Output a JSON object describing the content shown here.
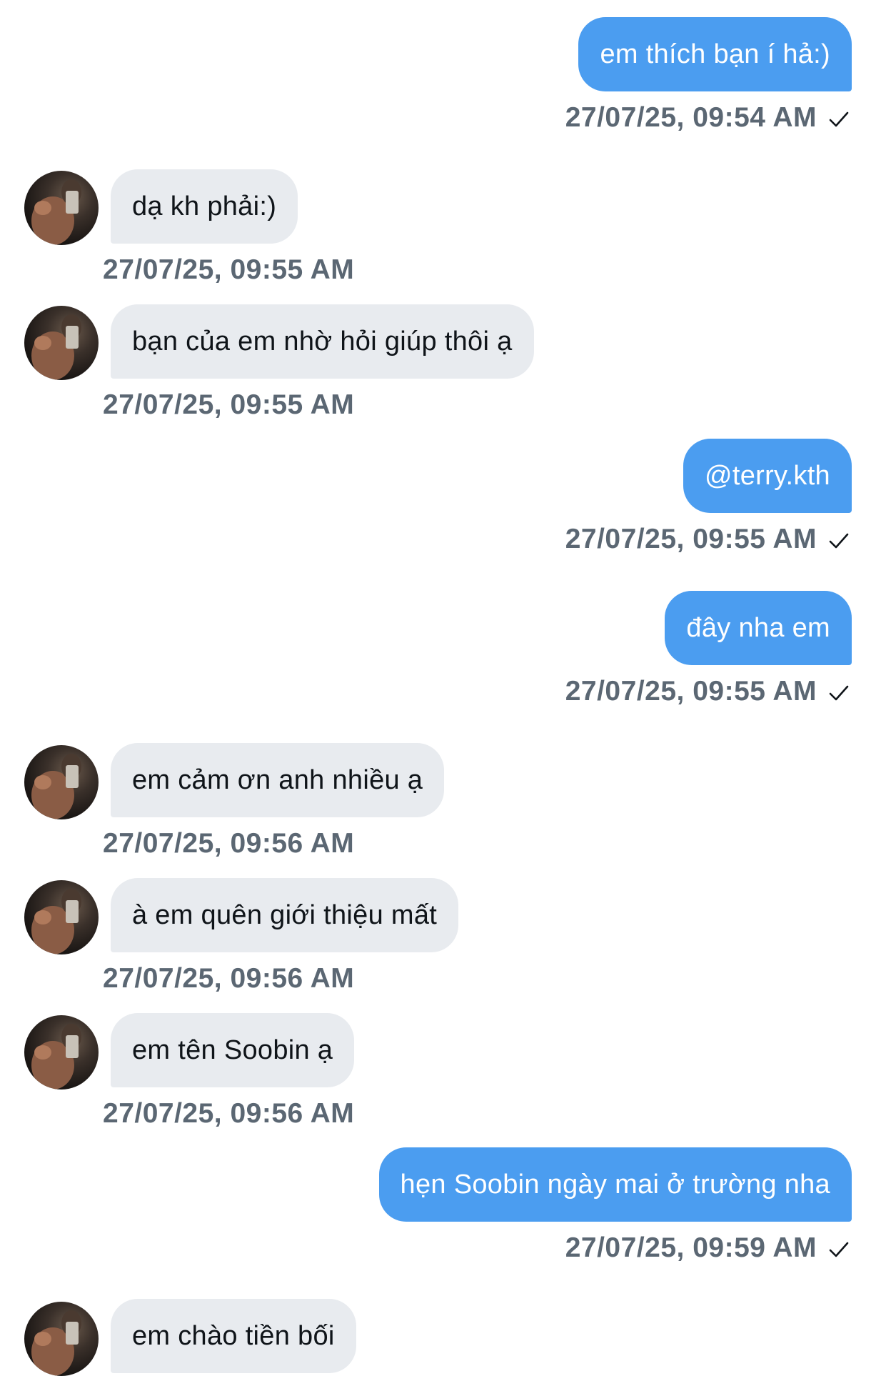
{
  "messages": [
    {
      "dir": "out",
      "text": "em thích bạn í hả:)",
      "time": "27/07/25, 09:54 AM"
    },
    {
      "dir": "in",
      "text": "dạ kh phải:)",
      "time": "27/07/25, 09:55 AM"
    },
    {
      "dir": "in",
      "text": "bạn của em nhờ hỏi giúp thôi ạ",
      "time": "27/07/25, 09:55 AM"
    },
    {
      "dir": "out",
      "text": "@terry.kth",
      "time": "27/07/25, 09:55 AM"
    },
    {
      "dir": "out",
      "text": "đây nha em",
      "time": "27/07/25, 09:55 AM"
    },
    {
      "dir": "in",
      "text": "em cảm ơn anh nhiều ạ",
      "time": "27/07/25, 09:56 AM"
    },
    {
      "dir": "in",
      "text": "à em quên giới thiệu mất",
      "time": "27/07/25, 09:56 AM"
    },
    {
      "dir": "in",
      "text": "em tên Soobin ạ",
      "time": "27/07/25, 09:56 AM"
    },
    {
      "dir": "out",
      "text": "hẹn Soobin ngày mai ở trường nha",
      "time": "27/07/25, 09:59 AM"
    },
    {
      "dir": "in",
      "text": "em chào tiền bối",
      "time": ""
    }
  ],
  "icons": {
    "sent_status": "checkmark-icon",
    "contact_avatar": "avatar"
  },
  "colors": {
    "outgoing_bubble": "#4b9df0",
    "incoming_bubble": "#e8ebef",
    "timestamp": "#5b6773",
    "background": "#ffffff"
  }
}
